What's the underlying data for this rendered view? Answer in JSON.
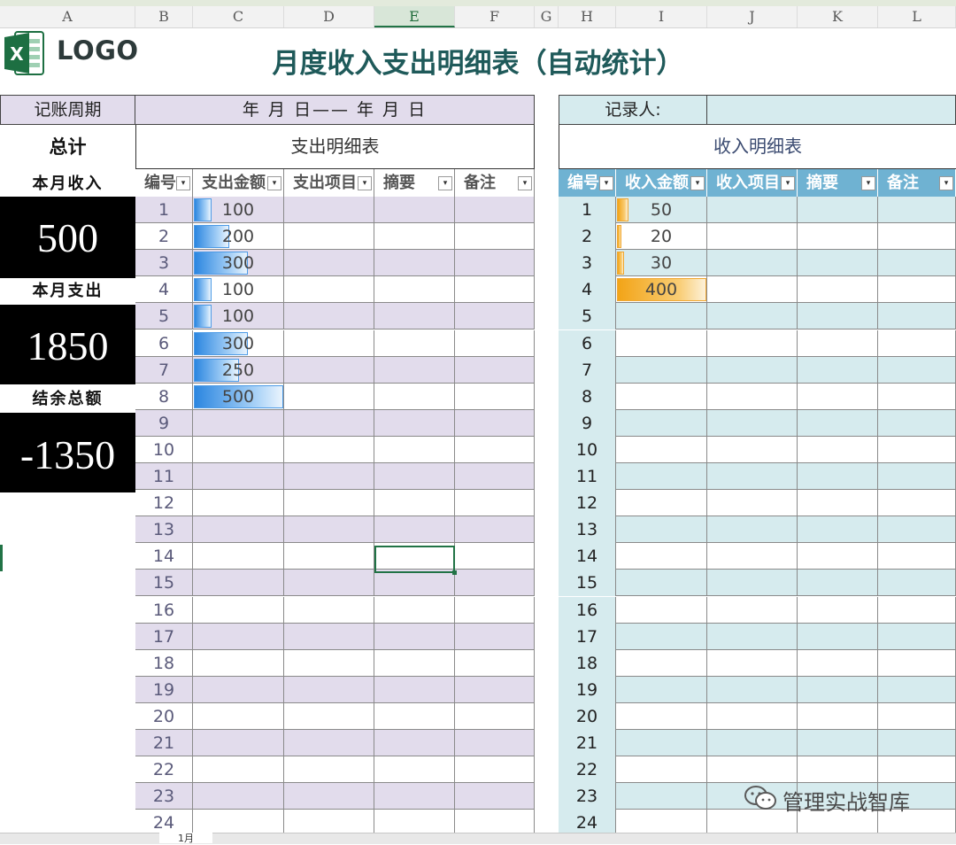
{
  "columns": [
    "A",
    "B",
    "C",
    "D",
    "E",
    "F",
    "G",
    "H",
    "I",
    "J",
    "K",
    "L"
  ],
  "selected_column": "E",
  "logo": {
    "icon": "excel-icon",
    "icon_letter": "X",
    "text": "LOGO"
  },
  "title": "月度收入支出明细表（自动统计）",
  "period": {
    "label": "记账周期",
    "value": "年  月  日——  年  月  日"
  },
  "recorder": {
    "label": "记录人:",
    "value": ""
  },
  "summary": {
    "total_label": "总计",
    "income_label": "本月收入",
    "income_value": "500",
    "expense_label": "本月支出",
    "expense_value": "1850",
    "balance_label": "结余总额",
    "balance_value": "-1350"
  },
  "expense_table": {
    "section_title": "支出明细表",
    "headers": [
      "编号",
      "支出金额",
      "支出项目",
      "摘要",
      "备注"
    ],
    "max_value": 500,
    "rows": [
      {
        "no": "1",
        "amount": "100"
      },
      {
        "no": "2",
        "amount": "200"
      },
      {
        "no": "3",
        "amount": "300"
      },
      {
        "no": "4",
        "amount": "100"
      },
      {
        "no": "5",
        "amount": "100"
      },
      {
        "no": "6",
        "amount": "300"
      },
      {
        "no": "7",
        "amount": "250"
      },
      {
        "no": "8",
        "amount": "500"
      },
      {
        "no": "9",
        "amount": ""
      },
      {
        "no": "10",
        "amount": ""
      },
      {
        "no": "11",
        "amount": ""
      },
      {
        "no": "12",
        "amount": ""
      },
      {
        "no": "13",
        "amount": ""
      },
      {
        "no": "14",
        "amount": ""
      },
      {
        "no": "15",
        "amount": ""
      },
      {
        "no": "16",
        "amount": ""
      },
      {
        "no": "17",
        "amount": ""
      },
      {
        "no": "18",
        "amount": ""
      },
      {
        "no": "19",
        "amount": ""
      },
      {
        "no": "20",
        "amount": ""
      },
      {
        "no": "21",
        "amount": ""
      },
      {
        "no": "22",
        "amount": ""
      },
      {
        "no": "23",
        "amount": ""
      },
      {
        "no": "24",
        "amount": ""
      }
    ]
  },
  "income_table": {
    "section_title": "收入明细表",
    "headers": [
      "编号",
      "收入金额",
      "收入项目",
      "摘要",
      "备注"
    ],
    "max_value": 400,
    "rows": [
      {
        "no": "1",
        "amount": "50"
      },
      {
        "no": "2",
        "amount": "20"
      },
      {
        "no": "3",
        "amount": "30"
      },
      {
        "no": "4",
        "amount": "400"
      },
      {
        "no": "5",
        "amount": ""
      },
      {
        "no": "6",
        "amount": ""
      },
      {
        "no": "7",
        "amount": ""
      },
      {
        "no": "8",
        "amount": ""
      },
      {
        "no": "9",
        "amount": ""
      },
      {
        "no": "10",
        "amount": ""
      },
      {
        "no": "11",
        "amount": ""
      },
      {
        "no": "12",
        "amount": ""
      },
      {
        "no": "13",
        "amount": ""
      },
      {
        "no": "14",
        "amount": ""
      },
      {
        "no": "15",
        "amount": ""
      },
      {
        "no": "16",
        "amount": ""
      },
      {
        "no": "17",
        "amount": ""
      },
      {
        "no": "18",
        "amount": ""
      },
      {
        "no": "19",
        "amount": ""
      },
      {
        "no": "20",
        "amount": ""
      },
      {
        "no": "21",
        "amount": ""
      },
      {
        "no": "22",
        "amount": ""
      },
      {
        "no": "23",
        "amount": ""
      },
      {
        "no": "24",
        "amount": ""
      }
    ]
  },
  "sheet_tab": "1月",
  "watermark": {
    "icon": "wechat-icon",
    "text": "管理实战智库"
  },
  "colors": {
    "expense_band": "#e2dcec",
    "income_band": "#d6ebee",
    "income_header": "#6fb2d2",
    "title": "#1f5a5a",
    "excel_green": "#217346"
  }
}
